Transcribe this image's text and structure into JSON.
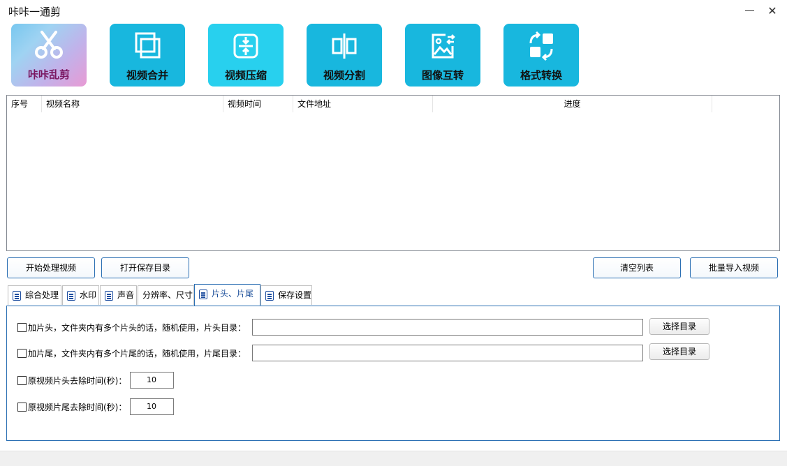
{
  "window": {
    "title": "咔咔一通剪"
  },
  "toolbar": {
    "logo_label": "咔咔乱剪",
    "tiles": [
      {
        "label": "视频合并",
        "icon": "merge-icon"
      },
      {
        "label": "视频压缩",
        "icon": "compress-icon"
      },
      {
        "label": "视频分割",
        "icon": "split-icon"
      },
      {
        "label": "图像互转",
        "icon": "image-convert-icon"
      },
      {
        "label": "格式转换",
        "icon": "format-convert-icon"
      }
    ]
  },
  "list": {
    "columns": [
      "序号",
      "视频名称",
      "视频时间",
      "文件地址",
      "进度"
    ]
  },
  "actions": {
    "start": "开始处理视频",
    "open_dir": "打开保存目录",
    "clear": "清空列表",
    "batch_import": "批量导入视频"
  },
  "tabs": [
    {
      "label": "综合处理"
    },
    {
      "label": "水印"
    },
    {
      "label": "声音"
    },
    {
      "label": "分辨率、尺寸"
    },
    {
      "label": "片头、片尾"
    },
    {
      "label": "保存设置"
    }
  ],
  "panel": {
    "intro_label": "加片头，文件夹内有多个片头的话，随机使用，片头目录：",
    "intro_path": "",
    "outro_label": "加片尾，文件夹内有多个片尾的话，随机使用，片尾目录：",
    "outro_path": "",
    "select_dir": "选择目录",
    "trim_head_label": "原视频片头去除时间(秒)：",
    "trim_head_value": "10",
    "trim_tail_label": "原视频片尾去除时间(秒)：",
    "trim_tail_value": "10"
  },
  "colors": {
    "tile": "#18b7de",
    "tile_light": "#28d0ee",
    "accent_border": "#2b6fb3"
  }
}
